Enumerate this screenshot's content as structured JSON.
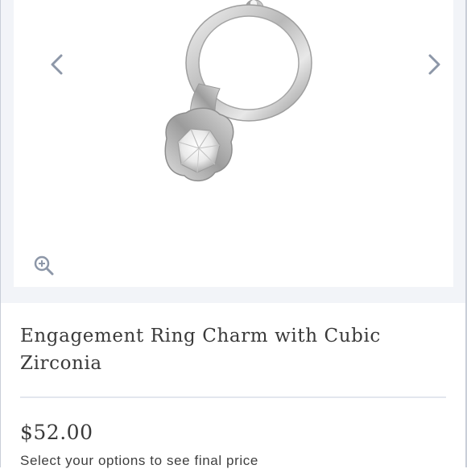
{
  "product": {
    "title": "Engagement Ring Charm with Cubic Zirconia",
    "price": "$52.00",
    "price_note": "Select your options to see final price"
  },
  "gallery": {
    "image_alt": "ring charm",
    "prev_icon": "chevron-left-icon",
    "next_icon": "chevron-right-icon",
    "zoom_icon": "zoom-in-icon"
  },
  "colors": {
    "background_band": "#f2f4f8",
    "text": "#3a3a3a",
    "arrow": "#8d97a8"
  }
}
